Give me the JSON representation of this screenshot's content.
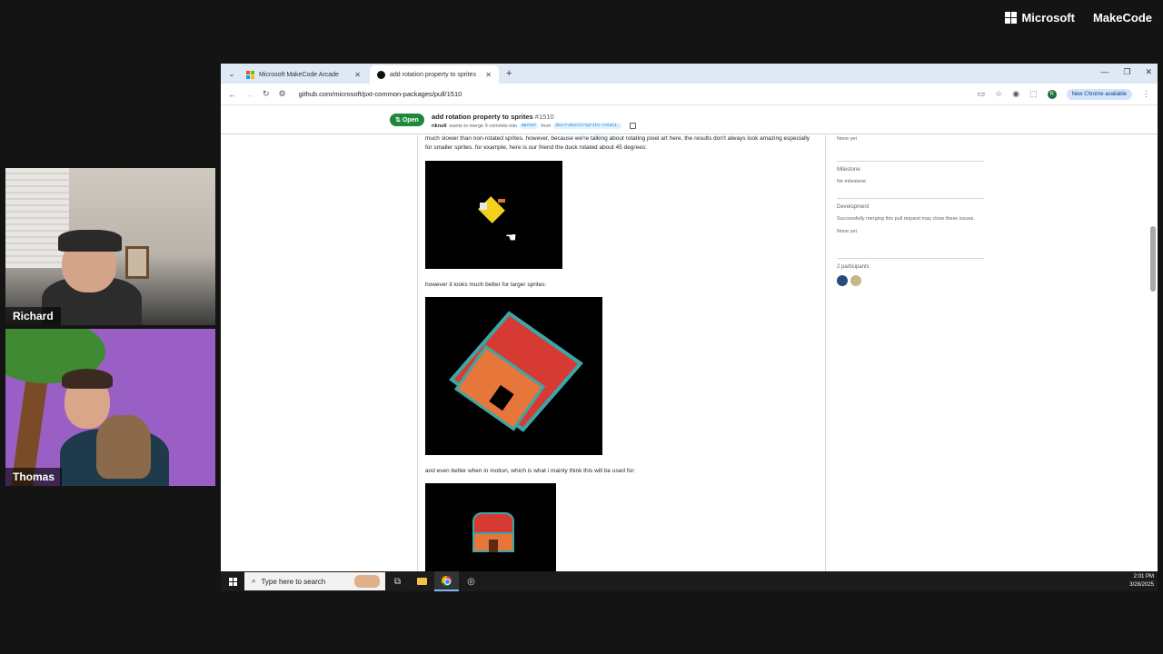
{
  "branding": {
    "microsoft": "Microsoft",
    "product": "MakeCode"
  },
  "participants_video": [
    {
      "name": "Richard"
    },
    {
      "name": "Thomas"
    }
  ],
  "browser": {
    "tabs": [
      {
        "label": "Microsoft MakeCode Arcade",
        "active": false
      },
      {
        "label": "add rotation property to sprites",
        "active": true
      }
    ],
    "url": "github.com/microsoft/pxt-common-packages/pull/1510",
    "update_label": "New Chrome available",
    "profile_initial": "R"
  },
  "pr": {
    "status": "Open",
    "title": "add rotation property to sprites",
    "number": "#1510",
    "author": "riknoll",
    "merge_text": "wants to merge 9 commits into",
    "base_branch": "master",
    "from_text": "from",
    "head_branch": "dev/riknoll/sprite-rotati…"
  },
  "comment": {
    "para1": "much slower than non-rotated sprites. however, because we're talking about rotating pixel art here, the results don't always look amazing especially for smaller sprites. for example, here is our friend the duck rotated about 45 degrees:",
    "para2": "however it looks much better for larger sprites:",
    "para3": "and even better when in motion, which is what i mainly think this will be used for:"
  },
  "sidebar": {
    "top_value": "None yet",
    "milestone_head": "Milestone",
    "milestone_value": "No milestone",
    "development_head": "Development",
    "development_text": "Successfully merging this pull request may close these issues.",
    "development_value": "None yet",
    "participants_head": "2 participants"
  },
  "taskbar": {
    "search_placeholder": "Type here to search",
    "time": "2:01 PM",
    "date": "3/28/2025"
  }
}
